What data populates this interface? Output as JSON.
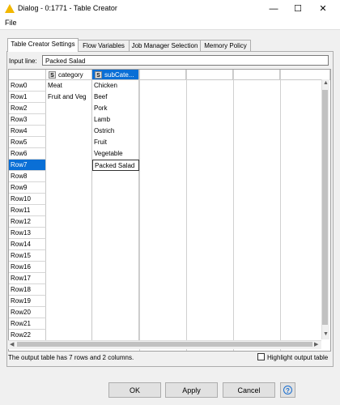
{
  "window": {
    "title": "Dialog - 0:1771 - Table Creator",
    "minimize": "—",
    "maximize": "☐",
    "close": "✕"
  },
  "menu": {
    "file": "File"
  },
  "tabs": [
    {
      "label": "Table Creator Settings",
      "active": true
    },
    {
      "label": "Flow Variables",
      "active": false
    },
    {
      "label": "Job Manager Selection",
      "active": false
    },
    {
      "label": "Memory Policy",
      "active": false
    }
  ],
  "input_line": {
    "label": "Input line:",
    "value": "Packed Salad"
  },
  "columns": [
    {
      "type": "S",
      "name": "category"
    },
    {
      "type": "S",
      "name": "subCate..."
    }
  ],
  "rows": [
    "Row0",
    "Row1",
    "Row2",
    "Row3",
    "Row4",
    "Row5",
    "Row6",
    "Row7",
    "Row8",
    "Row9",
    "Row10",
    "Row11",
    "Row12",
    "Row13",
    "Row14",
    "Row15",
    "Row16",
    "Row17",
    "Row18",
    "Row19",
    "Row20",
    "Row21",
    "Row22"
  ],
  "selected_row": "Row7",
  "cells": [
    {
      "category": "Meat",
      "subCategory": "Chicken"
    },
    {
      "category": "Fruit and Veg",
      "subCategory": "Beef"
    },
    {
      "category": "",
      "subCategory": "Pork"
    },
    {
      "category": "",
      "subCategory": "Lamb"
    },
    {
      "category": "",
      "subCategory": "Ostrich"
    },
    {
      "category": "",
      "subCategory": "Fruit"
    },
    {
      "category": "",
      "subCategory": "Vegetable"
    },
    {
      "category": "",
      "subCategory": "Packed Salad"
    }
  ],
  "status": "The output table has 7 rows and 2 columns.",
  "highlight_label": "Highlight output table",
  "buttons": {
    "ok": "OK",
    "apply": "Apply",
    "cancel": "Cancel",
    "help": "?"
  },
  "colors": {
    "selection": "#0a6fd6",
    "title_icon": "#f2b700"
  }
}
